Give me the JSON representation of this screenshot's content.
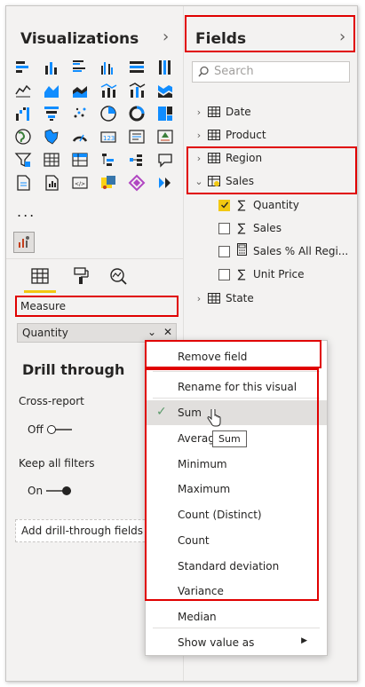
{
  "visualizations": {
    "title": "Visualizations",
    "icons": [
      "stacked-bar-chart-icon",
      "stacked-column-chart-icon",
      "clustered-bar-chart-icon",
      "clustered-column-chart-icon",
      "100-stacked-bar-chart-icon",
      "100-stacked-column-chart-icon",
      "line-chart-icon",
      "area-chart-icon",
      "stacked-area-chart-icon",
      "line-clustered-column-icon",
      "line-stacked-column-icon",
      "ribbon-chart-icon",
      "waterfall-chart-icon",
      "funnel-chart-icon",
      "scatter-chart-icon",
      "pie-chart-icon",
      "donut-chart-icon",
      "treemap-icon",
      "map-icon",
      "filled-map-icon",
      "gauge-icon",
      "card-icon",
      "multi-row-card-icon",
      "kpi-icon",
      "slicer-icon",
      "table-icon",
      "matrix-icon",
      "r-script-icon",
      "python-visual-icon",
      "key-influencers-icon",
      "decomposition-tree-icon",
      "qa-icon",
      "paginated-report-icon",
      "power-apps-icon",
      "power-automate-icon",
      "smart-narrative-icon"
    ],
    "more": "...",
    "tabs": [
      "fields-tab-icon",
      "format-tab-icon",
      "analytics-tab-icon"
    ],
    "measure_label": "Measure",
    "well_value": "Quantity",
    "drill_title": "Drill through",
    "cross_report_label": "Cross-report",
    "cross_report_state": "Off",
    "keep_filters_label": "Keep all filters",
    "keep_filters_state": "On",
    "add_drill_label": "Add drill-through fields here"
  },
  "fields": {
    "title": "Fields",
    "search_placeholder": "Search",
    "tables": [
      "Date",
      "Product",
      "Region",
      "Sales"
    ],
    "sales_fields": [
      {
        "label": "Quantity",
        "checked": true,
        "icon": "sigma-icon"
      },
      {
        "label": "Sales",
        "checked": false,
        "icon": "sigma-icon"
      },
      {
        "label": "Sales % All Regi...",
        "checked": false,
        "icon": "calculator-icon"
      },
      {
        "label": "Unit Price",
        "checked": false,
        "icon": "sigma-icon"
      }
    ],
    "last_table": "State"
  },
  "context_menu": {
    "remove": "Remove field",
    "rename": "Rename for this visual",
    "items": [
      "Sum",
      "Average",
      "Minimum",
      "Maximum",
      "Count (Distinct)",
      "Count",
      "Standard deviation",
      "Variance",
      "Median"
    ],
    "selected": "Sum",
    "show_value_as": "Show value as",
    "tooltip": "Sum"
  },
  "colors": {
    "accent": "#f2c811",
    "highlight_box": "#e00000",
    "check": "#5b9a6b"
  }
}
